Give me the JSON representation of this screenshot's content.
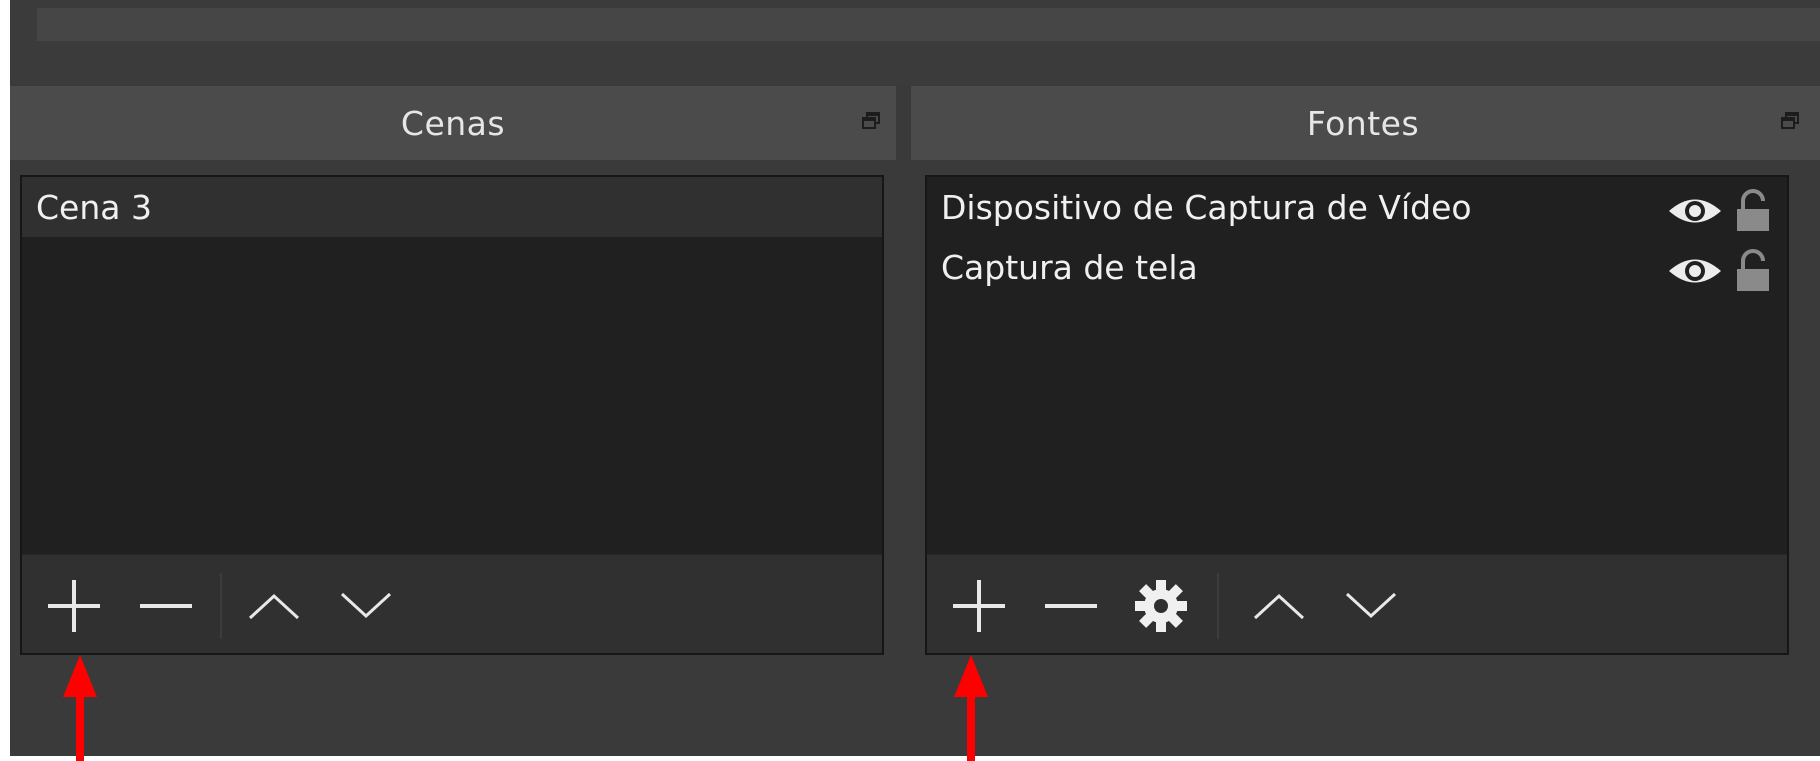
{
  "scenes_dock": {
    "title": "Cenas",
    "items": [
      {
        "label": "Cena 3",
        "selected": true
      }
    ],
    "toolbar": [
      "add-icon",
      "remove-icon",
      "move-up-icon",
      "move-down-icon"
    ]
  },
  "sources_dock": {
    "title": "Fontes",
    "items": [
      {
        "label": "Dispositivo de Captura de Vídeo",
        "visible": true,
        "locked": false
      },
      {
        "label": "Captura de tela",
        "visible": true,
        "locked": false
      }
    ],
    "toolbar": [
      "add-icon",
      "remove-icon",
      "gear-icon",
      "move-up-icon",
      "move-down-icon"
    ]
  },
  "annotations": {
    "arrow_color": "#ff0000"
  },
  "colors": {
    "background": "#3a3a3a",
    "panel": "#202020",
    "title_bar": "#4b4b4b",
    "text": "#f0f0f0"
  }
}
